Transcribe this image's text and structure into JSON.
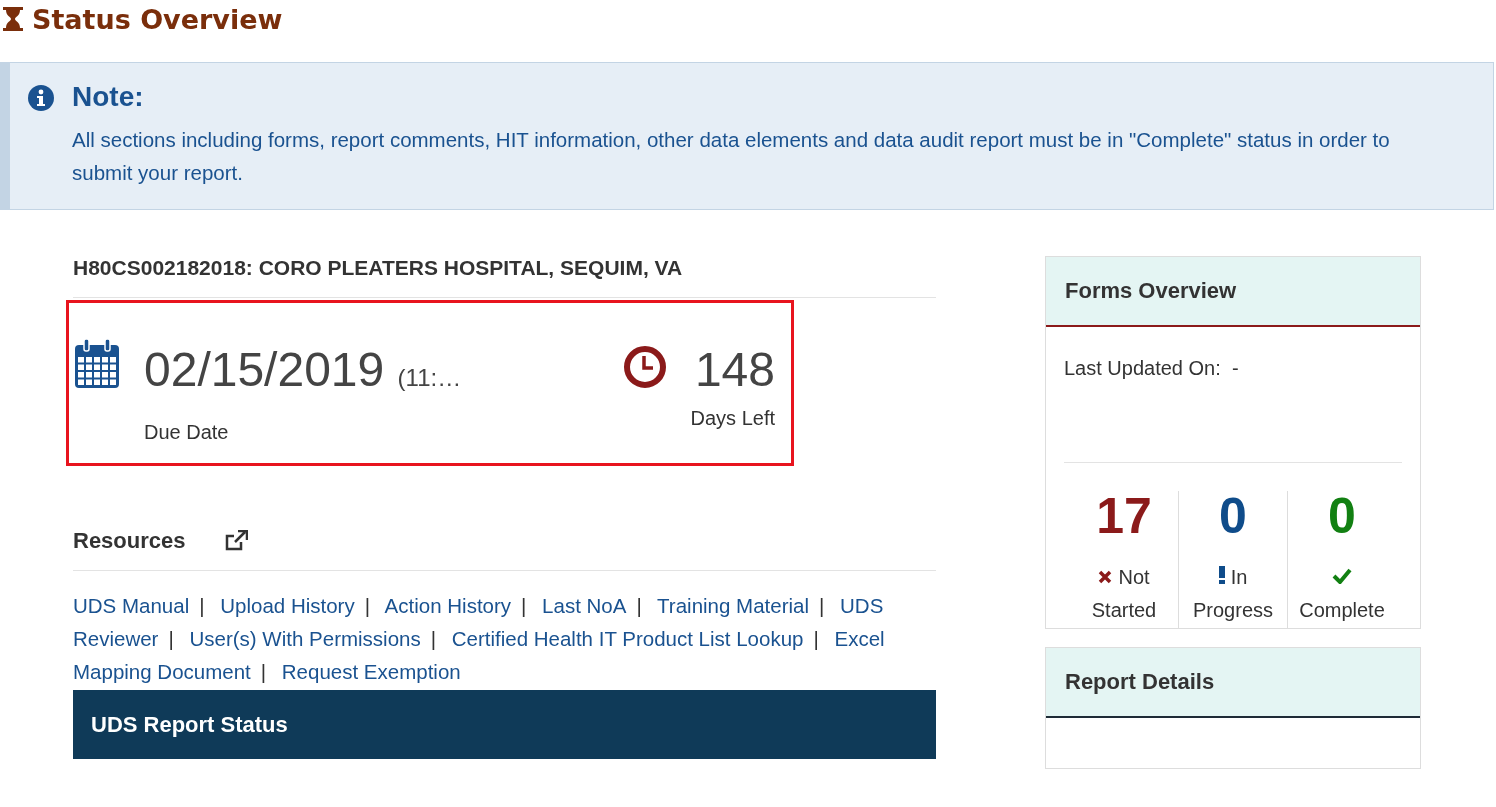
{
  "page_title": "Status Overview",
  "note": {
    "title": "Note:",
    "text": "All sections including forms, report comments, HIT information, other data elements and data audit report must be in \"Complete\" status in order to submit your report."
  },
  "report_heading": "H80CS002182018: CORO PLEATERS HOSPITAL, SEQUIM, VA",
  "due_panel": {
    "highlighted": true,
    "due_date": "02/15/2019",
    "due_time": "(11:…",
    "due_label": "Due Date",
    "days_left": "148",
    "days_label": "Days Left"
  },
  "resources": {
    "title": "Resources",
    "separator": "|",
    "links": [
      [
        "UDS Manual"
      ],
      [
        "Upload History"
      ],
      [
        "Action History"
      ],
      [
        "Last NoA"
      ],
      [
        "Training Material"
      ],
      [
        "UDS",
        "Reviewer"
      ],
      [
        "User(s) With Permissions"
      ],
      [
        "Certified Health IT Product List Lookup"
      ],
      [
        "Excel",
        "Mapping Document"
      ],
      [
        "Request Exemption"
      ]
    ]
  },
  "uds_report_status": {
    "title": "UDS Report Status"
  },
  "forms_overview": {
    "title": "Forms Overview",
    "last_updated_label": "Last Updated On:",
    "last_updated_value": "-",
    "stats": [
      {
        "kind": "not_started",
        "count": "17",
        "label": "Not Started",
        "color": "#8b1a1a"
      },
      {
        "kind": "in_progress",
        "count": "0",
        "label": "In Progress",
        "color": "#0f4c8a"
      },
      {
        "kind": "complete",
        "count": "0",
        "label": "Complete",
        "color": "#128012"
      }
    ]
  },
  "report_details": {
    "title": "Report Details"
  }
}
